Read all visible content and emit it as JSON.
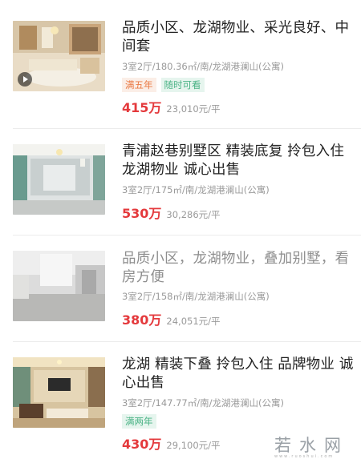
{
  "listings": [
    {
      "title": "品质小区、龙湖物业、采光良好、中间套",
      "meta": "3室2厅/180.36㎡/南/龙湖港澜山(公寓)",
      "tags": [
        "满五年",
        "随时可看"
      ],
      "price": "415万",
      "unit_price": "23,010元/平",
      "has_video": true,
      "read": false
    },
    {
      "title": "青浦赵巷别墅区 精装底复 拎包入住 龙湖物业 诚心出售",
      "meta": "3室2厅/175㎡/南/龙湖港澜山(公寓)",
      "tags": [],
      "price": "530万",
      "unit_price": "30,286元/平",
      "has_video": false,
      "read": false
    },
    {
      "title": "品质小区，龙湖物业，叠加别墅，看房方便",
      "meta": "3室2厅/158㎡/南/龙湖港澜山(公寓)",
      "tags": [],
      "price": "380万",
      "unit_price": "24,051元/平",
      "has_video": false,
      "read": true
    },
    {
      "title": "龙湖 精装下叠 拎包入住 品牌物业 诚心出售",
      "meta": "3室2厅/147.77㎡/南/龙湖港澜山(公寓)",
      "tags": [
        "满两年"
      ],
      "price": "430万",
      "unit_price": "29,100元/平",
      "has_video": false,
      "read": false
    }
  ],
  "watermark": {
    "text": "若水网",
    "sub": "www.ruoshui.com"
  },
  "colors": {
    "price": "#e4393c",
    "tag_orange": "#ea7a45",
    "tag_green": "#4bb386",
    "muted": "#9a9a9a"
  }
}
